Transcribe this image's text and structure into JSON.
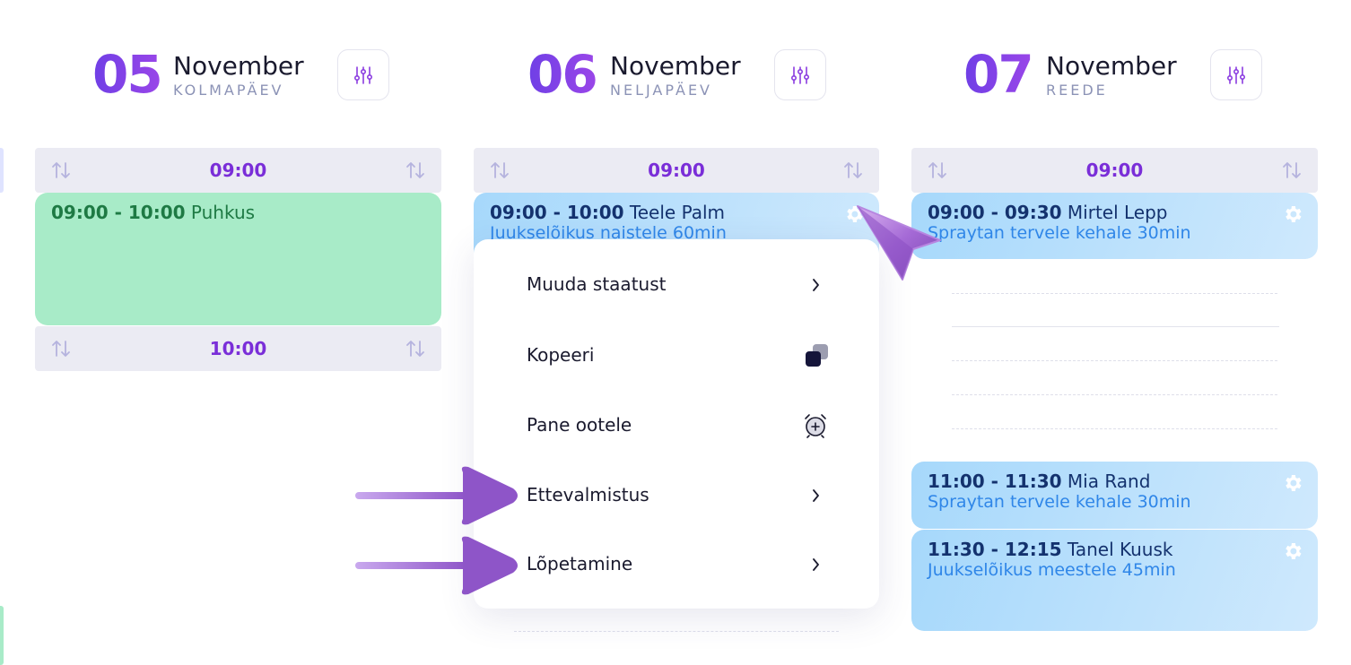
{
  "days": [
    {
      "num": "05",
      "month": "November",
      "weekday": "KOLMAPÄEV"
    },
    {
      "num": "06",
      "month": "November",
      "weekday": "NELJAPÄEV"
    },
    {
      "num": "07",
      "month": "November",
      "weekday": "REEDE"
    }
  ],
  "columns": [
    {
      "slots": [
        {
          "time": "09:00"
        },
        {
          "time": "10:00"
        }
      ],
      "events": [
        {
          "time_range": "09:00 - 10:00",
          "title": "Puhkus",
          "service": ""
        }
      ]
    },
    {
      "slots": [
        {
          "time": "09:00"
        }
      ],
      "events": [
        {
          "time_range": "09:00 - 10:00",
          "title": "Teele Palm",
          "service": "Juukselõikus naistele 60min"
        }
      ]
    },
    {
      "slots": [
        {
          "time": "09:00"
        }
      ],
      "events": [
        {
          "time_range": "09:00 - 09:30",
          "title": "Mirtel Lepp",
          "service": "Spraytan tervele kehale 30min"
        },
        {
          "time_range": "11:00 - 11:30",
          "title": "Mia Rand",
          "service": "Spraytan tervele kehale 30min"
        },
        {
          "time_range": "11:30 - 12:15",
          "title": "Tanel Kuusk",
          "service": "Juukselõikus meestele 45min"
        }
      ]
    }
  ],
  "context_menu": {
    "items": [
      {
        "label": "Muuda staatust",
        "icon": "chevron-right-icon"
      },
      {
        "label": "Kopeeri",
        "icon": "copy-icon"
      },
      {
        "label": "Pane ootele",
        "icon": "alarm-add-icon"
      },
      {
        "label": "Ettevalmistus",
        "icon": "chevron-right-icon"
      },
      {
        "label": "Lõpetamine",
        "icon": "chevron-right-icon"
      }
    ]
  },
  "colors": {
    "accent": "#7a2ed8",
    "slot_bg": "#ebebf3",
    "green_event": "#a8ebc8",
    "blue_event": "#a6d8fb",
    "pointer": "#8e55c8"
  },
  "decorations": {
    "pointer_icon": "cursor-arrow-icon",
    "arrow_icon": "pointer-arrow-icon"
  }
}
